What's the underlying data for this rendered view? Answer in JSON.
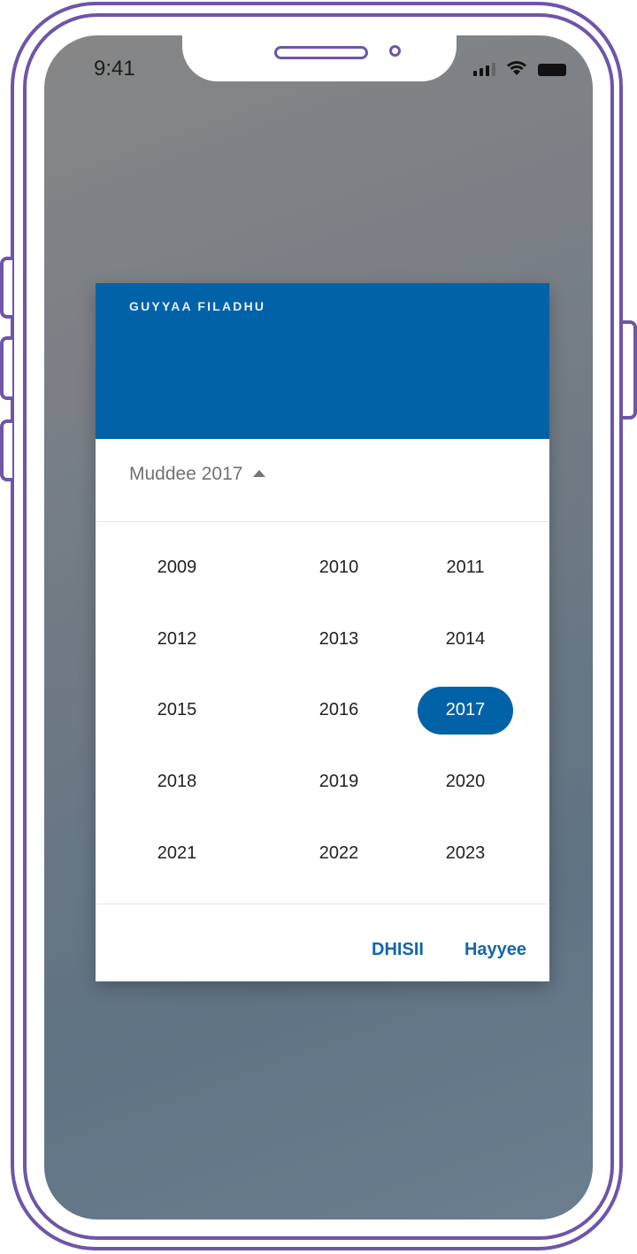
{
  "status_bar": {
    "time": "9:41",
    "icons": [
      "signal-icon",
      "wifi-icon",
      "battery-icon"
    ]
  },
  "dialog": {
    "title": "GUYYAA FILADHU",
    "month_selector": {
      "label": "Muddee 2017",
      "icon": "caret-up-icon"
    },
    "years": [
      "2009",
      "2010",
      "2011",
      "2012",
      "2013",
      "2014",
      "2015",
      "2016",
      "2017",
      "2018",
      "2019",
      "2020",
      "2021",
      "2022",
      "2023"
    ],
    "selected_year": "2017",
    "actions": {
      "cancel_label": "DHISII",
      "ok_label": "Hayyee"
    }
  },
  "colors": {
    "primary": "#0262a8",
    "frame": "#6e55a9"
  }
}
